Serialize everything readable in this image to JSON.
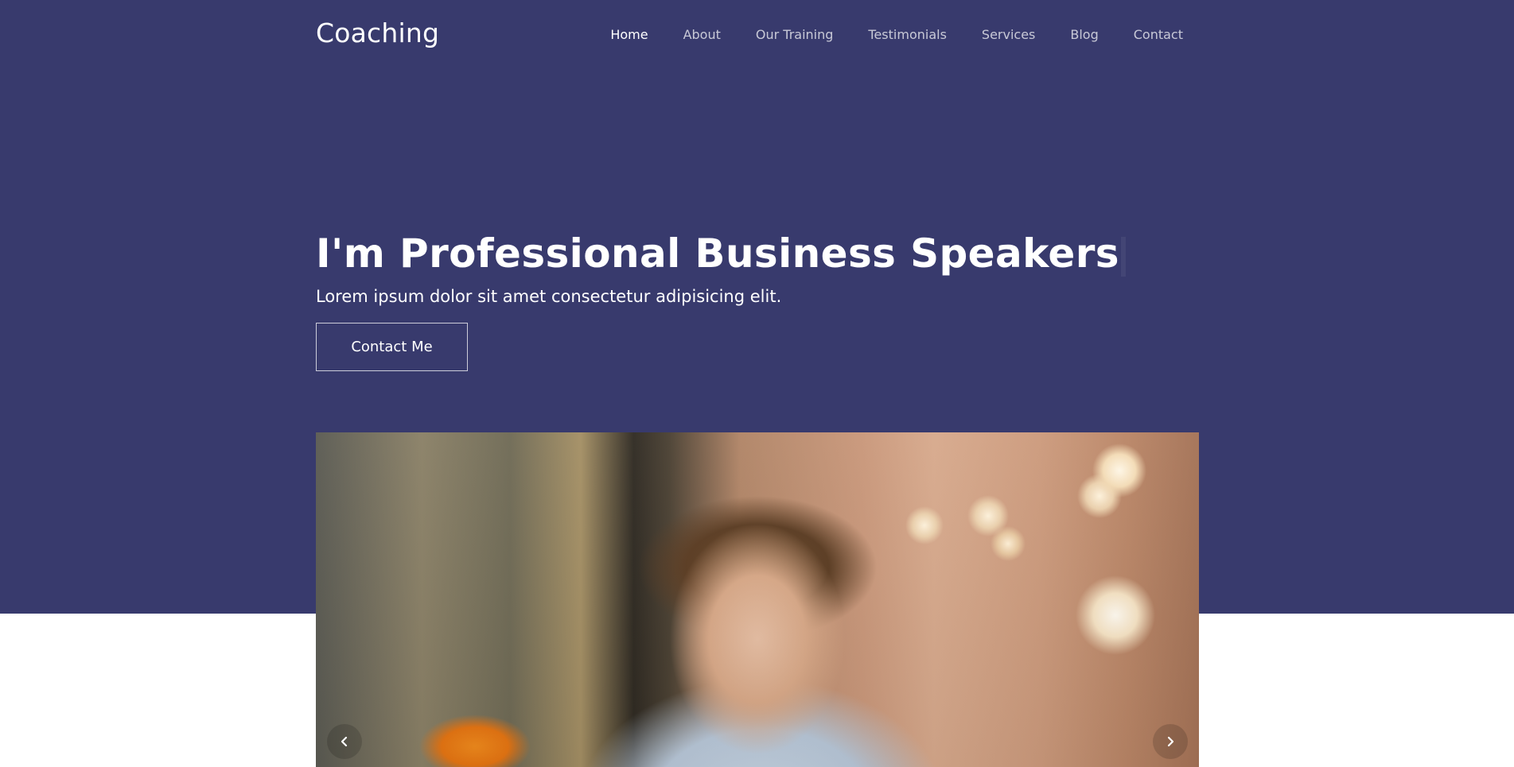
{
  "header": {
    "logo": "Coaching",
    "nav": [
      {
        "label": "Home",
        "active": true
      },
      {
        "label": "About",
        "active": false
      },
      {
        "label": "Our Training",
        "active": false
      },
      {
        "label": "Testimonials",
        "active": false
      },
      {
        "label": "Services",
        "active": false
      },
      {
        "label": "Blog",
        "active": false
      },
      {
        "label": "Contact",
        "active": false
      }
    ]
  },
  "hero": {
    "title": "I'm Professional Business Speakers",
    "subtitle": "Lorem ipsum dolor sit amet consectetur adipisicing elit.",
    "cta_label": "Contact Me"
  },
  "slider": {
    "prev_icon": "chevron-left-icon",
    "next_icon": "chevron-right-icon"
  },
  "colors": {
    "hero_background": "#383a6d",
    "text": "#ffffff",
    "page_background": "#ffffff"
  }
}
